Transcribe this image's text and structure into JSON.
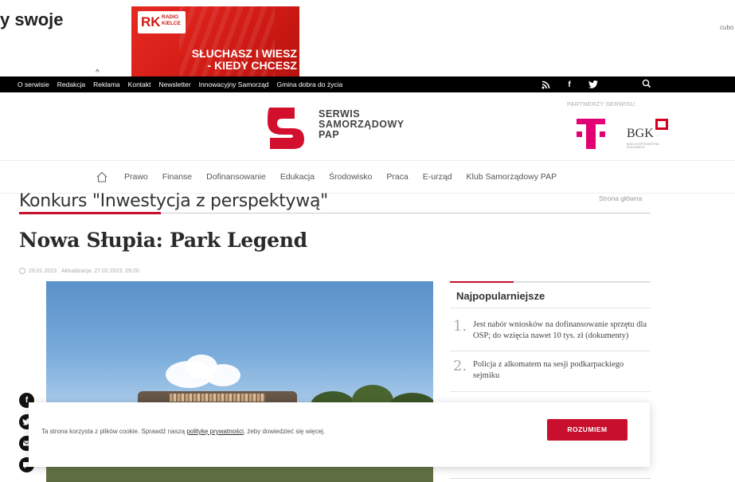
{
  "ad": {
    "left_text": "y swoje",
    "brand_rk": "RK",
    "brand_name": "RADIO KIELCE",
    "slogan_line1": "SŁUCHASZ I WIESZ",
    "slogan_line2": "- KIEDY CHCESZ",
    "right_text": "cubo"
  },
  "topnav": {
    "links": [
      "O serwisie",
      "Redakcja",
      "Reklama",
      "Kontakt",
      "Newsletter",
      "Innowacyjny Samorząd",
      "Gmina dobra do życia"
    ],
    "icons": [
      "rss-icon",
      "facebook-icon",
      "twitter-icon",
      "search-icon"
    ]
  },
  "header": {
    "logo_line1": "SERWIS",
    "logo_line2": "SAMORZĄDOWY",
    "logo_line3": "PAP",
    "partners_label": "PARTNERZY SERWISU:",
    "bgk_text": "BGK",
    "bgk_sub": "BANK GOSPODARSTWA KRAJOWEGO"
  },
  "catnav": {
    "items": [
      "Prawo",
      "Finanse",
      "Dofinansowanie",
      "Edukacja",
      "Środowisko",
      "Praca",
      "E-urząd",
      "Klub Samorządowy PAP"
    ]
  },
  "section": {
    "title": "Konkurs \"Inwestycja z perspektywą\"",
    "breadcrumb": "Strona główna"
  },
  "article": {
    "title": "Nowa Słupia: Park Legend",
    "date": "29.01.2023",
    "updated": "Aktualizacja: 27.02.2023, 09:20"
  },
  "popular": {
    "heading": "Najpopularniejsze",
    "items": [
      {
        "num": "1.",
        "text": "Jest nabór wniosków na dofinansowanie sprzętu dla OSP; do wzięcia nawet 10 tys. zł (dokumenty)"
      },
      {
        "num": "2.",
        "text": "Policja z alkomatem na sesji podkarpackiego sejmiku"
      }
    ]
  },
  "cookie": {
    "msg_before": "Ta strona korzysta z plików cookie. Sprawdź naszą ",
    "link": "politykę prywatności",
    "msg_after": ", żeby dowiedzieć się więcej.",
    "button": "ROZUMIEM"
  },
  "colors": {
    "accent": "#c8102e",
    "topnav_bg": "#000000",
    "tmobile": "#e20074"
  }
}
